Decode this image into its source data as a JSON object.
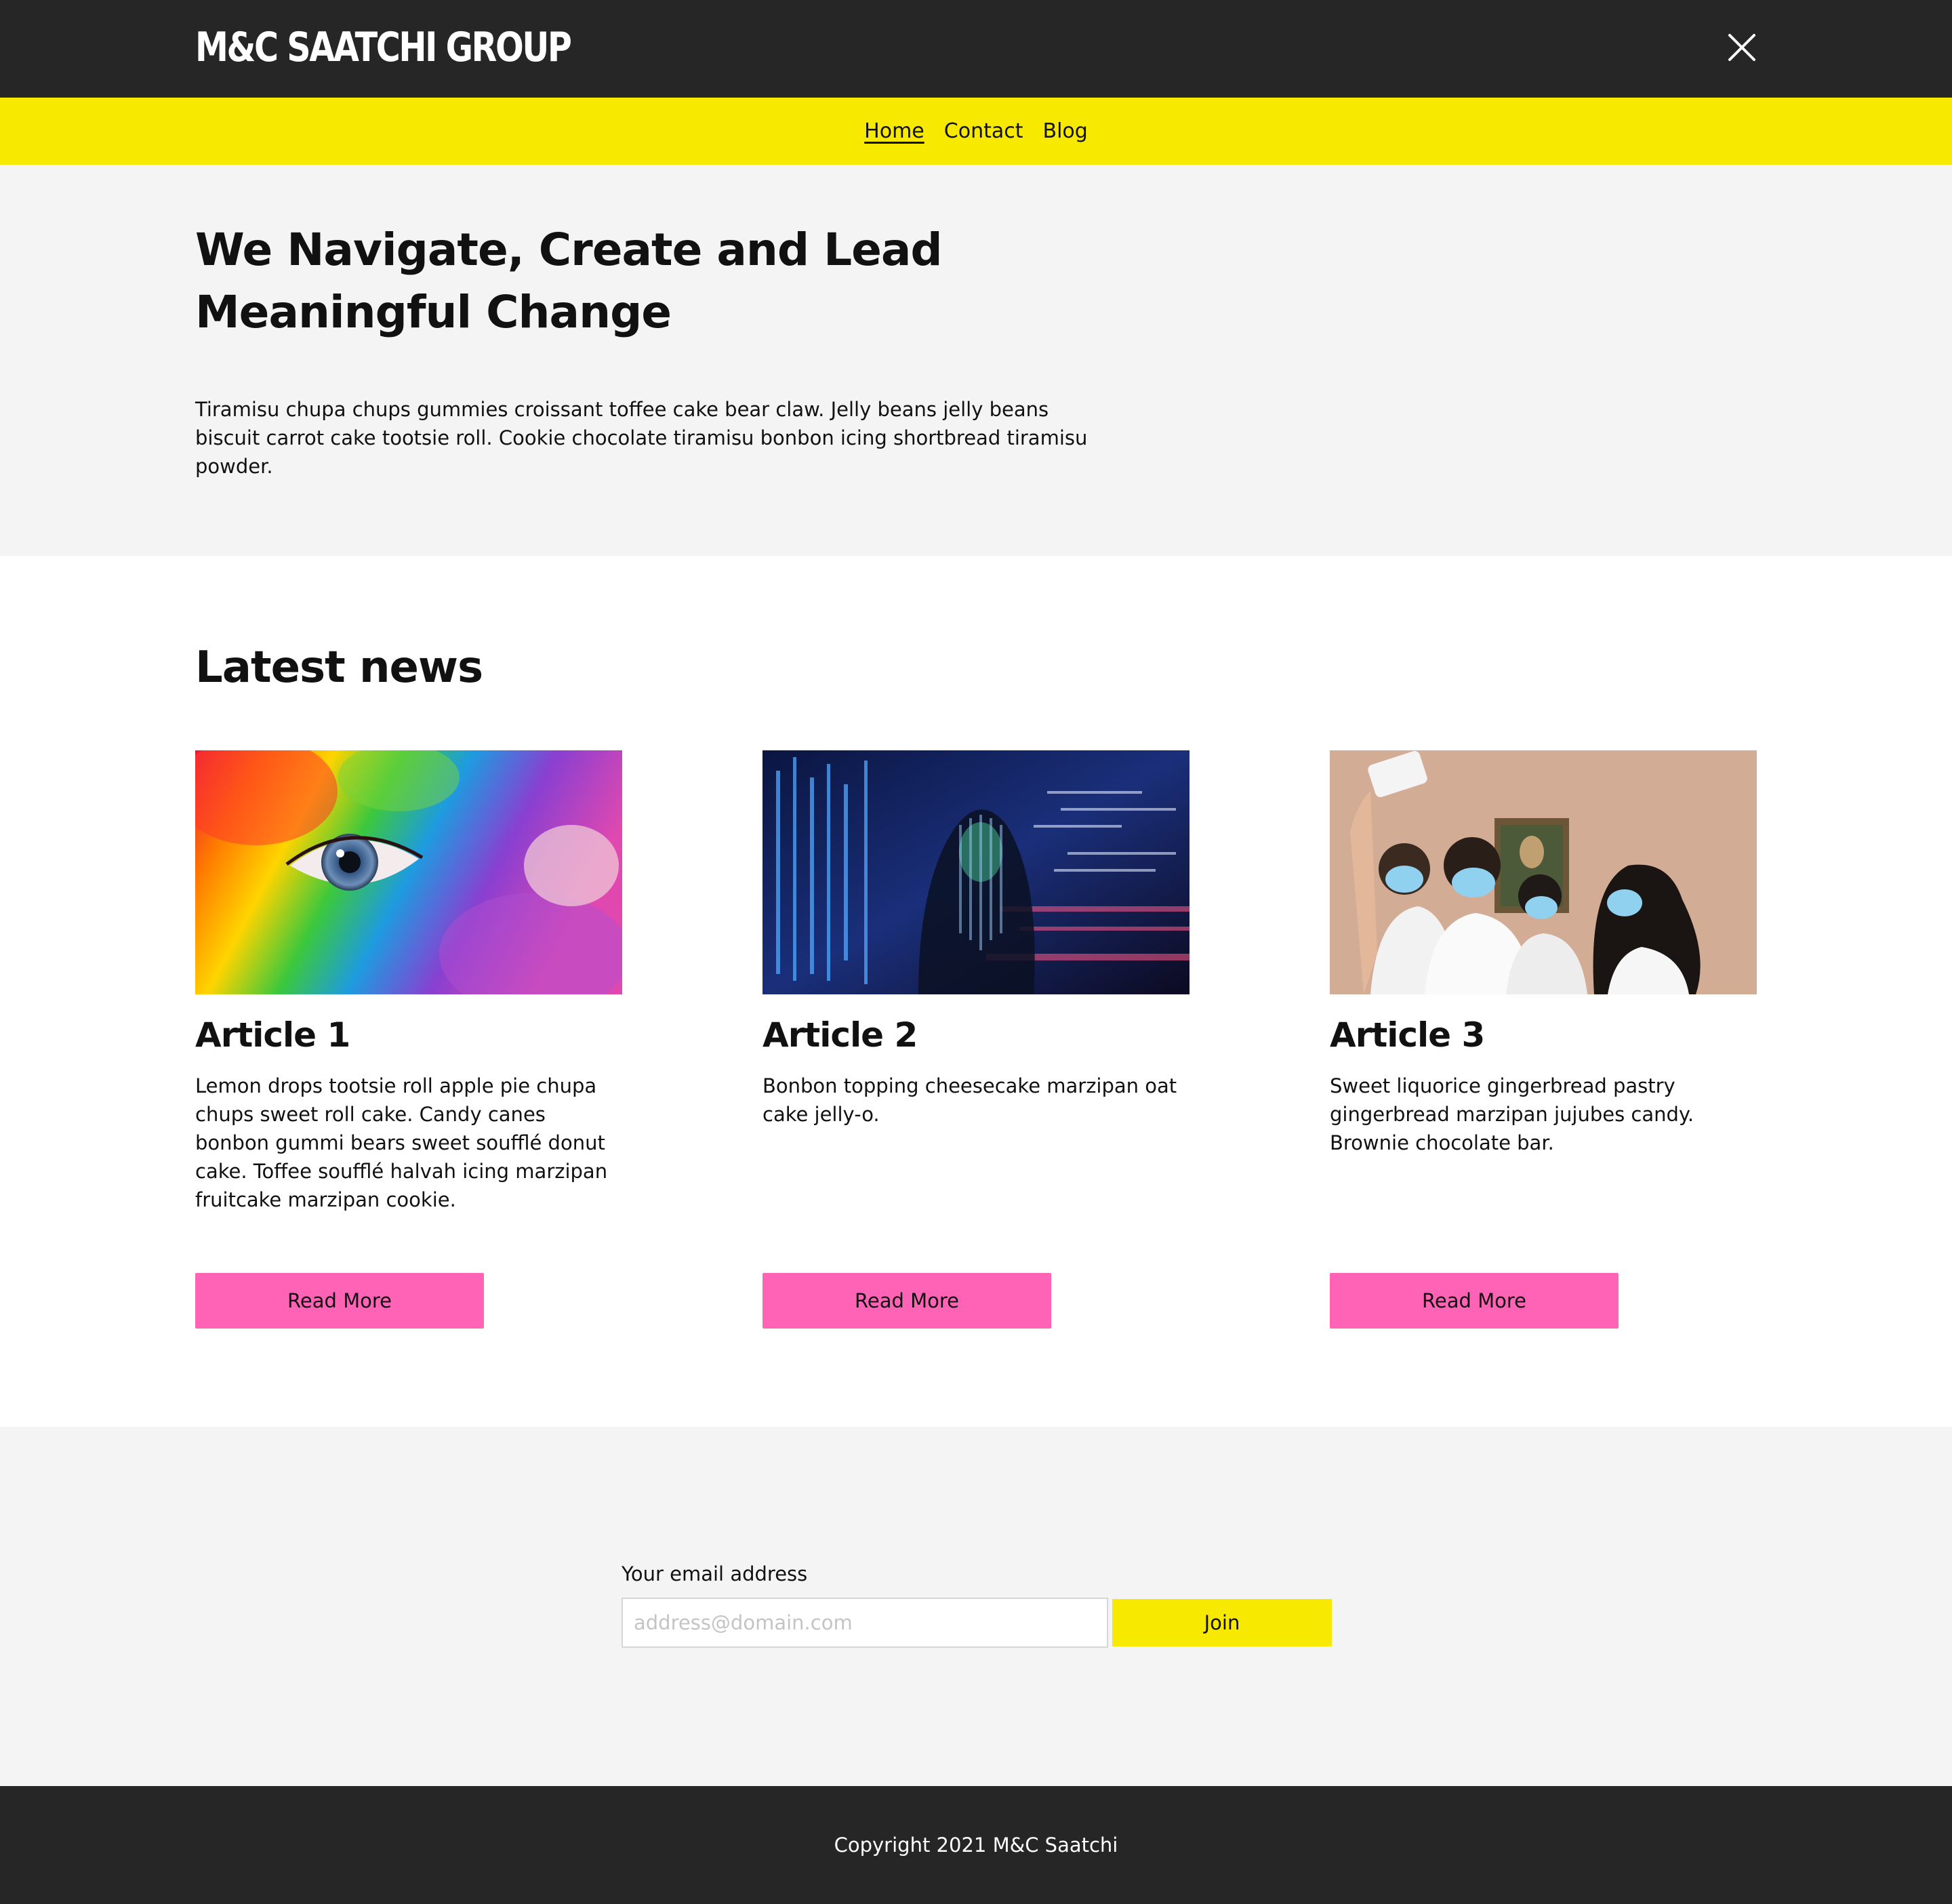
{
  "header": {
    "logo_text": "M&C SAATCHI GROUP",
    "close_icon": "close-icon"
  },
  "nav": {
    "items": [
      {
        "label": "Home",
        "active": true
      },
      {
        "label": "Contact",
        "active": false
      },
      {
        "label": "Blog",
        "active": false
      }
    ]
  },
  "hero": {
    "title": "We Navigate, Create and Lead Meaningful Change",
    "body": "Tiramisu chupa chups gummies croissant toffee cake bear claw. Jelly beans jelly beans biscuit carrot cake tootsie roll. Cookie chocolate tiramisu bonbon icing shortbread tiramisu powder."
  },
  "news": {
    "heading": "Latest news",
    "articles": [
      {
        "title": "Article 1",
        "body": "Lemon drops tootsie roll apple pie chupa chups sweet roll cake. Candy canes bonbon gummi bears sweet soufflé donut cake. Toffee soufflé halvah icing marzipan fruitcake marzipan cookie.",
        "button": "Read More"
      },
      {
        "title": "Article 2",
        "body": "Bonbon topping cheesecake marzipan oat cake jelly-o.",
        "button": "Read More"
      },
      {
        "title": "Article 3",
        "body": "Sweet liquorice gingerbread pastry gingerbread marzipan jujubes candy. Brownie chocolate bar.",
        "button": "Read More"
      }
    ]
  },
  "newsletter": {
    "label": "Your email address",
    "placeholder": "address@domain.com",
    "button": "Join"
  },
  "footer": {
    "copyright": "Copyright 2021 M&C Saatchi"
  },
  "colors": {
    "dark": "#262626",
    "yellow": "#f7ea00",
    "pink": "#ff63b6",
    "light_bg": "#f4f4f4"
  }
}
